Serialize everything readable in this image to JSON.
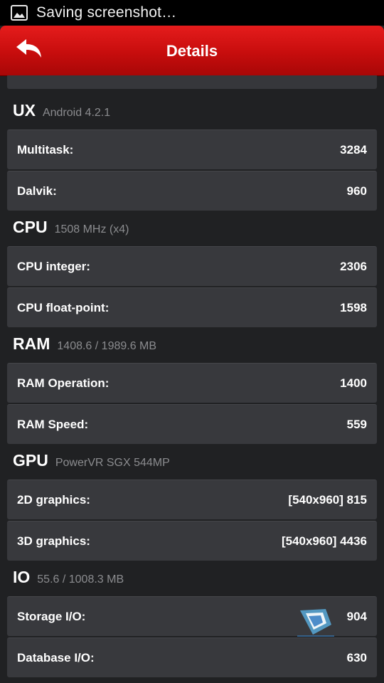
{
  "status_bar": {
    "notification_text": "Saving screenshot…",
    "icon": "image-icon"
  },
  "header": {
    "title": "Details",
    "back_icon": "back-arrow-icon",
    "accent": "#d01010"
  },
  "sections": [
    {
      "name": "UX",
      "detail": "Android 4.2.1",
      "rows": [
        {
          "label": "Multitask:",
          "value": "3284"
        },
        {
          "label": "Dalvik:",
          "value": "960"
        }
      ]
    },
    {
      "name": "CPU",
      "detail": "1508 MHz (x4)",
      "rows": [
        {
          "label": "CPU integer:",
          "value": "2306"
        },
        {
          "label": "CPU float-point:",
          "value": "1598"
        }
      ]
    },
    {
      "name": "RAM",
      "detail": "1408.6 / 1989.6 MB",
      "rows": [
        {
          "label": "RAM Operation:",
          "value": "1400"
        },
        {
          "label": "RAM Speed:",
          "value": "559"
        }
      ]
    },
    {
      "name": "GPU",
      "detail": "PowerVR SGX 544MP",
      "rows": [
        {
          "label": "2D graphics:",
          "value": "[540x960] 815"
        },
        {
          "label": "3D graphics:",
          "value": "[540x960] 4436"
        }
      ]
    },
    {
      "name": "IO",
      "detail": "55.6 / 1008.3 MB",
      "rows": [
        {
          "label": "Storage I/O:",
          "value": "904"
        },
        {
          "label": "Database I/O:",
          "value": "630"
        }
      ]
    }
  ]
}
